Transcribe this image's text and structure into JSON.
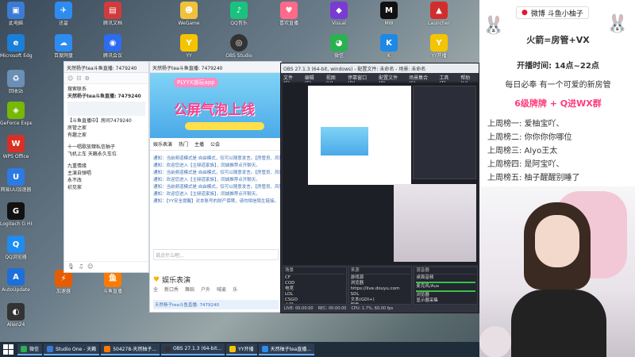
{
  "desktop_icons": [
    {
      "label": "此电脑",
      "color": "#3a7bd5"
    },
    {
      "label": "迅雷",
      "color": "#2d8cf0"
    },
    {
      "label": "腾讯文档",
      "color": "#d23b3b"
    },
    {
      "label": "WeGame",
      "color": "#f0c23a"
    },
    {
      "label": "QQ音乐",
      "color": "#19c37d"
    },
    {
      "label": "喜欢直播",
      "color": "#ff6a8a"
    },
    {
      "label": "Visual",
      "color": "#7a3bd5"
    },
    {
      "label": "MW",
      "color": "#111111"
    },
    {
      "label": "Launcher",
      "color": "#d22d2d"
    },
    {
      "label": "Microsoft Edge",
      "color": "#1a7fd8"
    },
    {
      "label": "百度网盘",
      "color": "#2d8cf0"
    },
    {
      "label": "腾讯会议",
      "color": "#2d6cf0"
    },
    {
      "label": "YY",
      "color": "#f5c400"
    },
    {
      "label": "OBS Studio",
      "color": "#333333"
    },
    {
      "label": "微信",
      "color": "#2ab150"
    },
    {
      "label": "K",
      "color": "#1e88e5"
    },
    {
      "label": "YY开播",
      "color": "#f5c400"
    },
    {
      "label": "回收站",
      "color": "#6b8fb5"
    },
    {
      "label": "GeForce Experience",
      "color": "#76b900"
    },
    {
      "label": "WPS Office",
      "color": "#d93025"
    },
    {
      "label": "网易UU加速器",
      "color": "#2c7be5"
    },
    {
      "label": "Logitech G HUB",
      "color": "#111111"
    },
    {
      "label": "QQ浏览器",
      "color": "#1e8cf0"
    },
    {
      "label": "AutoUpdate",
      "color": "#1e6fd8"
    },
    {
      "label": "Alien24",
      "color": "#333333"
    },
    {
      "label": "加速器",
      "color": "#e65c00"
    },
    {
      "label": "斗鱼直播",
      "color": "#ff7a00"
    }
  ],
  "chat_window": {
    "title": "天然杨子tea斗鱼直播: 7479240",
    "header": "天然杨子tea斗鱼直播: 7479240",
    "items": [
      "搜索联系",
      "【斗鱼直播中】房间7479240",
      "房管之家",
      "有趣之家",
      "十一唱歌放肆私信柚子",
      "飞机上车 天籁永久车位",
      "九重情缘",
      "主演自弹唱",
      "永不改",
      "初见家"
    ]
  },
  "live_room": {
    "title": "天然杨子tea斗鱼直播: 7479240",
    "banner_sub": "PLYYX迪玩app",
    "banner_big": "公屏气泡上线",
    "tabs": [
      "娱乐表演",
      "热门",
      "主播",
      "公会"
    ],
    "messages": [
      "通知：当前频道模式是 自由模式，仅可以随意发言。【房管员、风管】",
      "通知：欢迎您进入【主频道家族】，同城推荐点开聊天。",
      "通知：当前频道模式是 自由模式，仅可以随意发言。【房管员、风管】",
      "通知：欢迎您进入【主频道家族】，同城推荐点开聊天。",
      "通知：当前频道模式是 自由模式，仅可以随意发言。【房管员、风管】",
      "通知：欢迎您进入【主频道家族】，同城推荐点开聊天。",
      "通知：【YY安全提醒】对本账号的财产保障，请勿相信陌生链接。"
    ],
    "input_placeholder": "说点什么吧...",
    "section_title": "娱乐表演",
    "section_tabs": [
      "全",
      "新口秀",
      "舞蹈",
      "户外",
      "喊麦",
      "乐"
    ],
    "bottom_bar": "天然杨子tea斗鱼直播: 7479240"
  },
  "obs": {
    "title": "OBS 27.1.3 (64-bit, windows) - 配置文件: 未命名 - 场景: 未命名",
    "menu": [
      "文件(F)",
      "编辑(E)",
      "视图(V)",
      "停靠窗口(D)",
      "配置文件(P)",
      "场景集合(S)",
      "工具(T)",
      "帮助(H)"
    ],
    "scenes_header": "场景",
    "scenes": [
      "CF",
      "COD",
      "电竞",
      "LOL",
      "CSGO",
      "小轮"
    ],
    "sources_header": "来源",
    "sources": [
      "游戏源",
      "浏览器",
      "https://live.douyu.com",
      "SDL",
      "文本(GDI+)",
      "图像",
      "显示器采集",
      "单独化屏幕"
    ],
    "mixer_header": "混音器",
    "mixer": [
      "桌面音频",
      "麦克风/Aux",
      "浏览器",
      "显示器采集"
    ],
    "status": [
      "LIVE: 00:00:00",
      "REC: 00:00:00",
      "CPU: 1.7%, 60.00 fps"
    ]
  },
  "overlay": {
    "brand": "微博 斗鱼小柚子",
    "fire_line": "火箭=房管+VX",
    "time": "开播时间: 14点~22点",
    "welcome": "每日必奉 有一个可爱的新房管",
    "group": "6级牌牌 + Q进WX群",
    "weekly": [
      "上周榜一: 爱柚宝吖、",
      "上周榜二: 你你你你哪位",
      "上周榜三: Alyo王太",
      "上周榜四: 是阿宝吖、",
      "上周榜五: 柚子醒醒别睡了"
    ]
  },
  "taskbar": [
    {
      "label": "微信",
      "color": "#2ab150"
    },
    {
      "label": "Studio One - 天籁",
      "color": "#3a7bd5"
    },
    {
      "label": "504278-天然柚子...",
      "color": "#ff7a00"
    },
    {
      "label": "OBS 27.1.3 (64-bit...",
      "color": "#333333"
    },
    {
      "label": "YY开播",
      "color": "#f5c400"
    },
    {
      "label": "天然柚子tea直播...",
      "color": "#2d8cf0"
    }
  ],
  "colors": {
    "accent": "#ff3b7a",
    "obs_bg": "#2b2e38",
    "taskbar": "#1f2c3a"
  }
}
